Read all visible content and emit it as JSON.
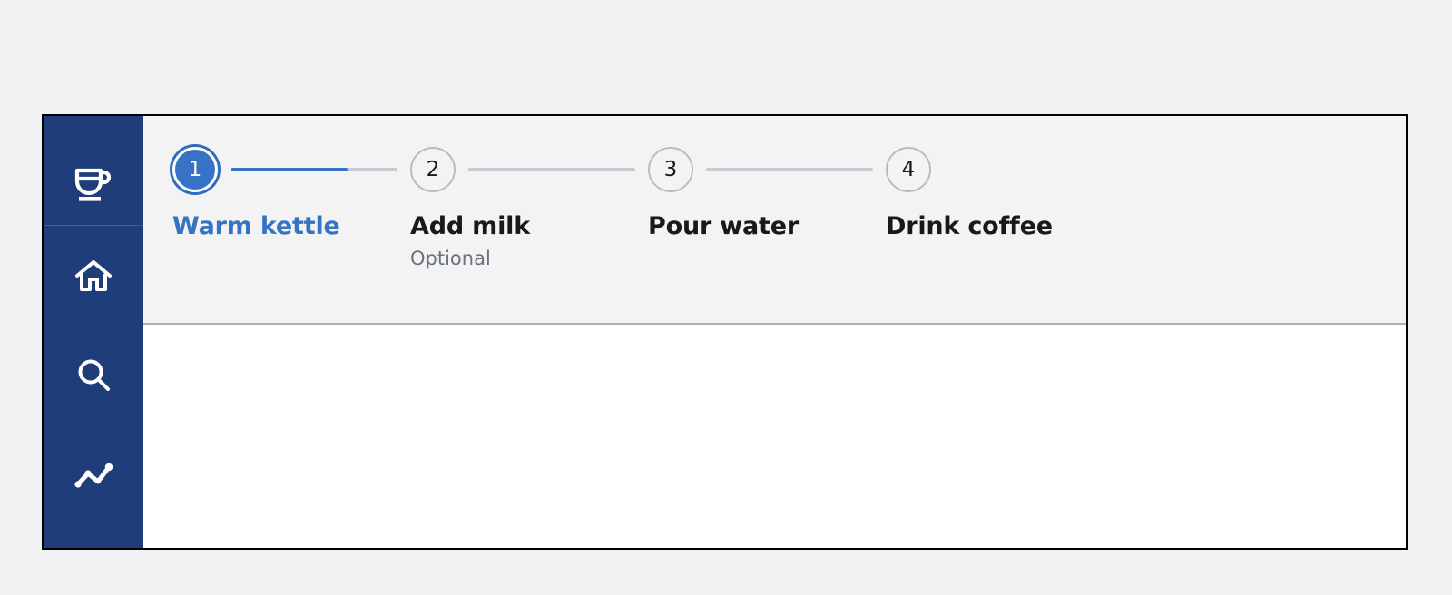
{
  "app": {
    "background_color": "#f2f2f2",
    "frame_border_color": "#000000",
    "header_background": "#f3f3f3",
    "content_background": "#ffffff"
  },
  "sidebar": {
    "background_color": "#1f3e79",
    "logo": {
      "icon": "coffee-cup-icon",
      "label": "Coffee"
    },
    "items": [
      {
        "icon": "home-icon",
        "label": "Home"
      },
      {
        "icon": "search-icon",
        "label": "Search"
      },
      {
        "icon": "line-chart-icon",
        "label": "Analytics"
      }
    ]
  },
  "stepper": {
    "active_color": "#3773c4",
    "inactive_color": "#b6bcc6",
    "active_index": 0,
    "progress_percent": 70,
    "steps": [
      {
        "number": "1",
        "label": "Warm kettle",
        "sub": "",
        "state": "active"
      },
      {
        "number": "2",
        "label": "Add milk",
        "sub": "Optional",
        "state": "inactive"
      },
      {
        "number": "3",
        "label": "Pour water",
        "sub": "",
        "state": "inactive"
      },
      {
        "number": "4",
        "label": "Drink coffee",
        "sub": "",
        "state": "inactive"
      }
    ]
  },
  "content": {
    "text": ""
  }
}
